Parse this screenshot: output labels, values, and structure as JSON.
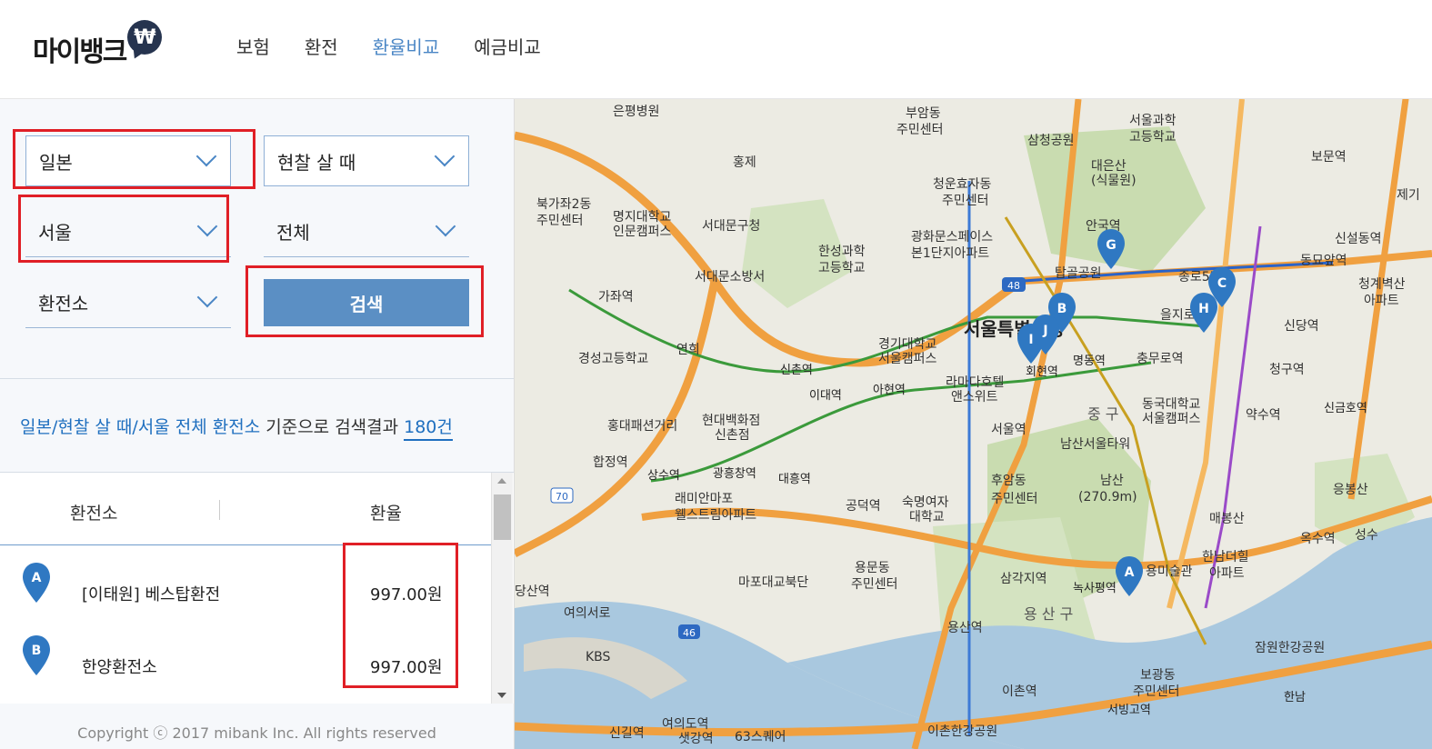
{
  "header": {
    "logo_text": "마이뱅크",
    "logo_symbol": "₩",
    "nav": [
      {
        "label": "보험",
        "active": false
      },
      {
        "label": "환전",
        "active": false
      },
      {
        "label": "환율비교",
        "active": true
      },
      {
        "label": "예금비교",
        "active": false
      }
    ]
  },
  "filters": {
    "country": "일본",
    "trade_type": "현찰 살 때",
    "region": "서울",
    "district": "전체",
    "place_type": "환전소",
    "search_label": "검색"
  },
  "summary": {
    "highlight": "일본/현찰 살 때/서울 전체 환전소",
    "text": " 기준으로 검색결과",
    "count": "180건"
  },
  "results": {
    "columns": [
      "환전소",
      "환율"
    ],
    "rows": [
      {
        "marker": "A",
        "name": "[이태원] 베스탑환전",
        "rate": "997.00원"
      },
      {
        "marker": "B",
        "name": "한양환전소",
        "rate": "997.00원"
      }
    ]
  },
  "footer": {
    "copyright": "Copyright ⓒ 2017 mibank Inc. All rights reserved"
  },
  "map": {
    "labels": [
      "은평병원",
      "부암동 주민센터",
      "서울과학 고등학교",
      "보문역",
      "삼청공원",
      "북가좌2동 주민센터",
      "명지대학교 인문캠퍼스",
      "서대문구청",
      "청운효자동 주민센터",
      "대은산 (식물원)",
      "한성과학 고등학교",
      "광화문스페이스 본1단지아파트",
      "안국역",
      "신설동역",
      "서대문소방서",
      "탑골공원",
      "종로5가",
      "동묘앞역",
      "청계벽산 아파트",
      "가좌역",
      "서울특별시청",
      "을지로",
      "신당역",
      "경성고등학교",
      "연희",
      "경기대학교 서울캠퍼스",
      "라마다호텔 앤스위트",
      "회현역",
      "명동역",
      "충무로역",
      "청구역",
      "신촌역",
      "이대역",
      "아현역",
      "동국대학교 서울캠퍼스",
      "약수역",
      "홍대패션거리",
      "현대백화점 신촌점",
      "서울역",
      "중구",
      "남산서울타워",
      "신금호역",
      "합정역",
      "상수역",
      "광흥창역",
      "대흥역",
      "래미안마포 웰스트림아파트",
      "공덕역",
      "숙명여자 대학교",
      "후암동 주민센터",
      "남산 (270.9m)",
      "매봉산",
      "옥수역",
      "용문동 주민센터",
      "마포대교북단",
      "삼각지역",
      "녹사평역",
      "용미술관",
      "한남더힐 아파트",
      "여의서로",
      "용산구",
      "용산역",
      "KBS",
      "보광동 주민센터",
      "여의도역",
      "63스퀘어",
      "이촌역",
      "서빙고역",
      "신길역",
      "샛강역",
      "이촌한강공원",
      "잠원한강공원",
      "당산역",
      "홍제",
      "삼청공원",
      "제기",
      "성수",
      "응봉산",
      "금호역",
      "한남역"
    ],
    "markers": [
      "A",
      "B",
      "C",
      "G",
      "H",
      "I",
      "J"
    ],
    "road_numbers": [
      "48",
      "70",
      "46"
    ]
  }
}
